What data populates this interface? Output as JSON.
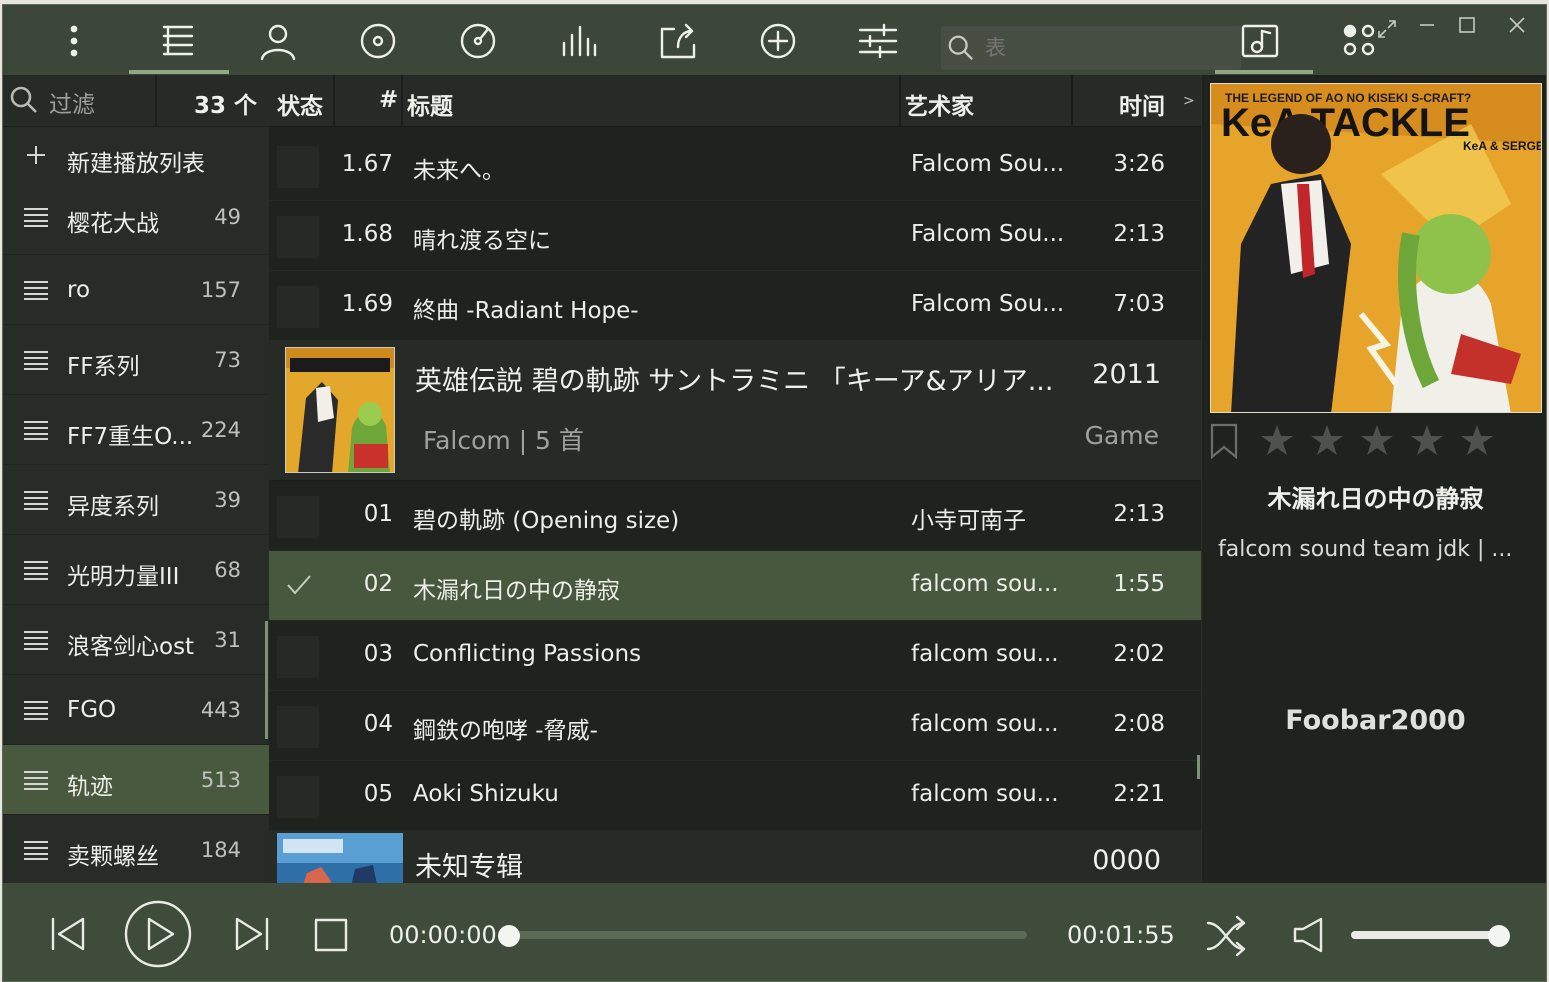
{
  "toolbar": {
    "search_placeholder": "表"
  },
  "sidebar": {
    "filter_label": "过滤",
    "playlist_count": "33 个",
    "new_playlist_label": "新建播放列表",
    "items": [
      {
        "name": "樱花大战",
        "count": "49"
      },
      {
        "name": "ro",
        "count": "157"
      },
      {
        "name": "FF系列",
        "count": "73"
      },
      {
        "name": "FF7重生O...",
        "count": "224"
      },
      {
        "name": "异度系列",
        "count": "39"
      },
      {
        "name": "光明力量III",
        "count": "68"
      },
      {
        "name": "浪客剑心ost",
        "count": "31"
      },
      {
        "name": "FGO",
        "count": "443"
      },
      {
        "name": "轨迹",
        "count": "513"
      },
      {
        "name": "卖颗螺丝",
        "count": "184"
      }
    ]
  },
  "columns": {
    "status": "状态",
    "number": "#",
    "title": "标题",
    "artist": "艺术家",
    "time": "时间",
    "more": ">"
  },
  "tracks_before": [
    {
      "num": "1.67",
      "title": "未来へ。",
      "artist": "Falcom Sou...",
      "time": "3:26"
    },
    {
      "num": "1.68",
      "title": "晴れ渡る空に",
      "artist": "Falcom Sou...",
      "time": "2:13"
    },
    {
      "num": "1.69",
      "title": "終曲 -Radiant Hope-",
      "artist": "Falcom Sou...",
      "time": "7:03"
    }
  ],
  "album": {
    "title": "英雄伝説 碧の軌跡 サントラミニ 「キーア&アリア...",
    "year": "2011",
    "subtitle": "Falcom | 5 首",
    "genre": "Game",
    "cover_text": "KeA TACKLE"
  },
  "tracks": [
    {
      "num": "01",
      "title": "碧の軌跡 (Opening size)",
      "artist": "小寺可南子",
      "time": "2:13"
    },
    {
      "num": "02",
      "title": "木漏れ日の中の静寂",
      "artist": "falcom sou...",
      "time": "1:55"
    },
    {
      "num": "03",
      "title": "Conflicting Passions",
      "artist": "falcom sou...",
      "time": "2:02"
    },
    {
      "num": "04",
      "title": "鋼鉄の咆哮 -脅威-",
      "artist": "falcom sou...",
      "time": "2:08"
    },
    {
      "num": "05",
      "title": "Aoki Shizuku",
      "artist": "falcom sou...",
      "time": "2:21"
    }
  ],
  "next_album": {
    "title": "未知专辑",
    "year": "0000"
  },
  "now_playing": {
    "title": "木漏れ日の中の静寂",
    "artist": "falcom sound team jdk  |  ...",
    "footer": "Foobar2000",
    "cover_headline": "KeA TACKLE",
    "cover_sub": "KeA & SERGEI",
    "cover_top": "THE LEGEND OF AO NO KISEKI S-CRAFT?",
    "rating": 0
  },
  "player": {
    "current_time": "00:00:00",
    "total_time": "00:01:55",
    "progress": 0.0,
    "volume": 1.0
  },
  "colors": {
    "accent": "#8ea886",
    "active_row": "#47583e",
    "toolbar_bg": "#3d4739",
    "player_bg": "#3f4b3b"
  }
}
